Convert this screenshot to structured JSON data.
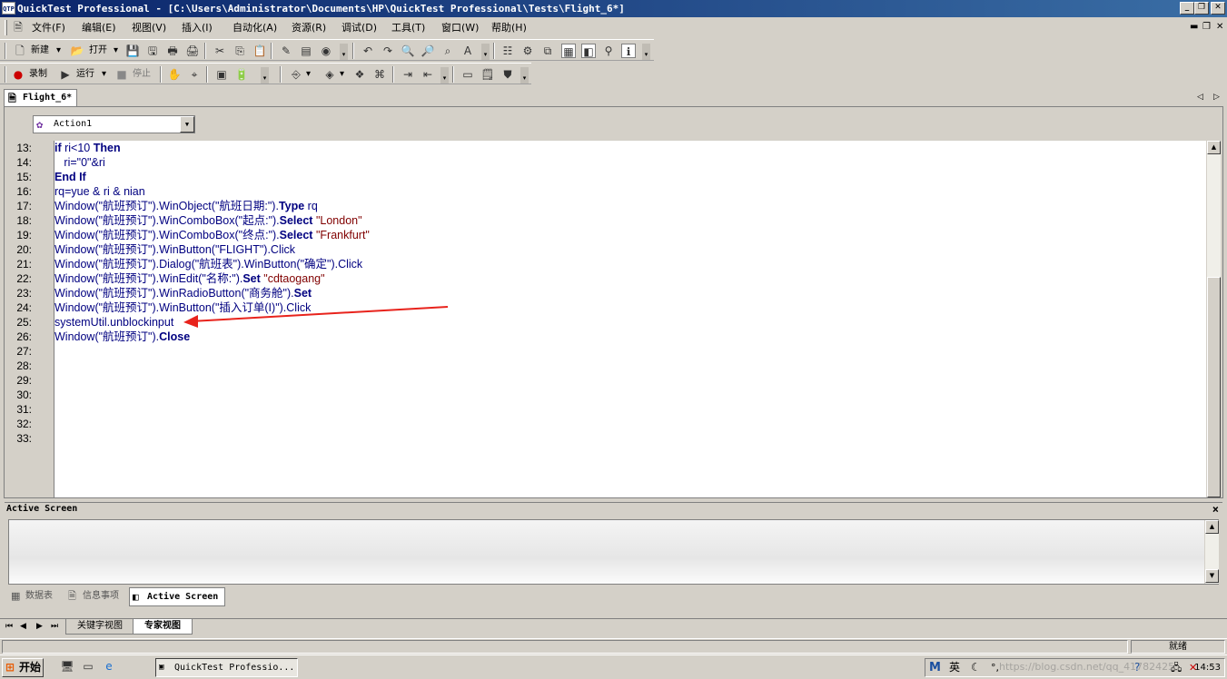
{
  "window": {
    "title": "QuickTest Professional - [C:\\Users\\Administrator\\Documents\\HP\\QuickTest Professional\\Tests\\Flight_6*]",
    "app_icon": "QTP"
  },
  "menu": [
    "文件(F)",
    "编辑(E)",
    "视图(V)",
    "插入(I)",
    "自动化(A)",
    "资源(R)",
    "调试(D)",
    "工具(T)",
    "窗口(W)",
    "帮助(H)"
  ],
  "toolbar1": {
    "new_label": "新建",
    "open_label": "打开"
  },
  "toolbar2": {
    "record_label": "录制",
    "run_label": "运行",
    "stop_label": "停止"
  },
  "document": {
    "tab_label": "Flight_6*",
    "action_select": "Action1"
  },
  "code": {
    "line_numbers": [
      "13:",
      "14:",
      "15:",
      "16:",
      "17:",
      "18:",
      "19:",
      "20:",
      "21:",
      "22:",
      "23:",
      "24:",
      "25:",
      "26:",
      "27:",
      "28:",
      "29:",
      "30:",
      "31:",
      "32:",
      "33:"
    ],
    "lines": [
      {
        "t1": "if",
        "t2": " ri<10 ",
        "t3": "Then",
        "t4": "",
        "t5": ""
      },
      {
        "t1": "",
        "t2": "   ri=\"0\"&ri",
        "t3": "",
        "t4": "",
        "t5": ""
      },
      {
        "t1": "End If",
        "t2": "",
        "t3": "",
        "t4": "",
        "t5": ""
      },
      {
        "t1": "",
        "t2": "rq=yue & ri & nian",
        "t3": "",
        "t4": "",
        "t5": ""
      },
      {
        "t1": "",
        "t2": "Window(\"航班预订\").WinObject(\"航班日期:\").",
        "t3": "Type",
        "t4": " rq",
        "t5": ""
      },
      {
        "t1": "",
        "t2": "Window(\"航班预订\").WinComboBox(\"起点:\").",
        "t3": "Select",
        "t4": " ",
        "t5": "\"London\""
      },
      {
        "t1": "",
        "t2": "Window(\"航班预订\").WinComboBox(\"终点:\").",
        "t3": "Select",
        "t4": " ",
        "t5": "\"Frankfurt\""
      },
      {
        "t1": "",
        "t2": "Window(\"航班预订\").WinButton(\"FLIGHT\").Click",
        "t3": "",
        "t4": "",
        "t5": ""
      },
      {
        "t1": "",
        "t2": "Window(\"航班预订\").Dialog(\"航班表\").WinButton(\"确定\").Click",
        "t3": "",
        "t4": "",
        "t5": ""
      },
      {
        "t1": "",
        "t2": "Window(\"航班预订\").WinEdit(\"名称:\").",
        "t3": "Set",
        "t4": " ",
        "t5": "\"cdtaogang\""
      },
      {
        "t1": "",
        "t2": "Window(\"航班预订\").WinRadioButton(\"商务舱\").",
        "t3": "Set",
        "t4": "",
        "t5": ""
      },
      {
        "t1": "",
        "t2": "Window(\"航班预订\").WinButton(\"插入订单(I)\").Click",
        "t3": "",
        "t4": "",
        "t5": ""
      },
      {
        "t1": "",
        "t2": "systemUtil.unblockinput",
        "t3": "",
        "t4": "",
        "t5": ""
      },
      {
        "t1": "",
        "t2": "Window(\"航班预订\").",
        "t3": "Close",
        "t4": "",
        "t5": ""
      }
    ]
  },
  "active_screen": {
    "title": "Active Screen",
    "close": "×"
  },
  "bottom_tabs": [
    "数据表",
    "信息事项",
    "Active Screen"
  ],
  "view_tabs": [
    "关键字视图",
    "专家视图"
  ],
  "status": {
    "text": "就绪"
  },
  "taskbar": {
    "start_label": "开始",
    "task_label": "QuickTest Professio...",
    "clock": "14:53",
    "watermark": "https://blog.csdn.net/qq_41782425"
  },
  "colors": {
    "title_start": "#0a246a",
    "title_end": "#3a6ea5",
    "keyword": "#000080",
    "string": "#800000",
    "arrow": "#e8231c"
  }
}
